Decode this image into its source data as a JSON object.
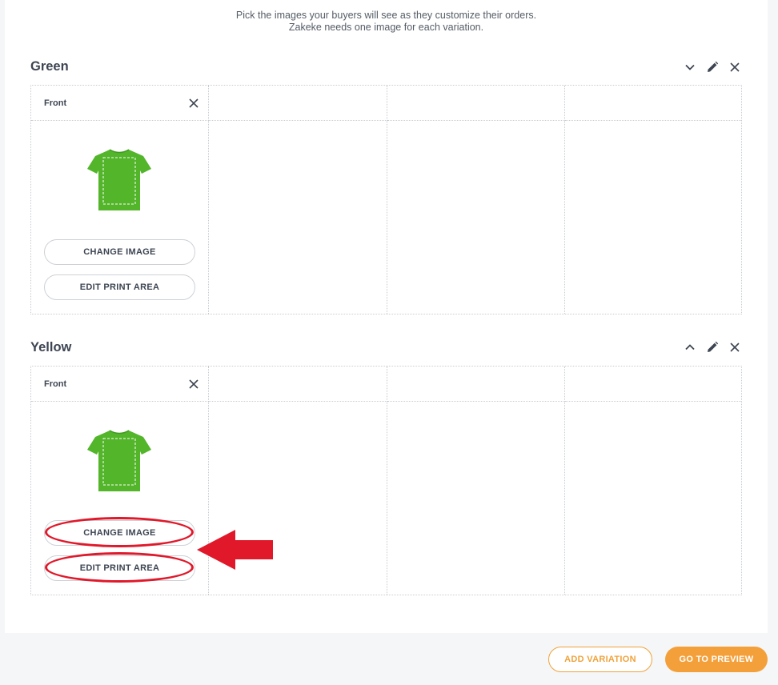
{
  "intro": {
    "line1": "Pick the images your buyers will see as they customize their orders.",
    "line2": "Zakeke needs one image for each variation."
  },
  "variations": [
    {
      "title": "Green",
      "side_label": "Front",
      "change_image_label": "CHANGE IMAGE",
      "edit_print_area_label": "EDIT PRINT AREA"
    },
    {
      "title": "Yellow",
      "side_label": "Front",
      "change_image_label": "CHANGE IMAGE",
      "edit_print_area_label": "EDIT PRINT AREA"
    }
  ],
  "footer": {
    "add_variation_label": "ADD VARIATION",
    "go_to_preview_label": "GO TO PREVIEW"
  },
  "icons": {
    "collapse": "chevron-down-icon",
    "expand": "chevron-up-icon",
    "edit": "pencil-icon",
    "remove": "close-icon"
  },
  "colors": {
    "accent": "#f4a03a",
    "shirt": "#52b52a",
    "annotation": "#e0182a",
    "text": "#3d4552"
  }
}
